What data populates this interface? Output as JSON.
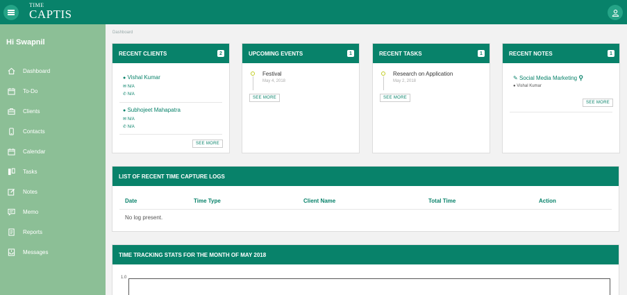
{
  "header": {
    "logo_top": "TIME",
    "logo_bottom": "CAPTIS",
    "menu_icon": "hamburger-icon",
    "user_icon": "user-icon"
  },
  "sidebar": {
    "greeting": "Hi Swapnil",
    "items": [
      {
        "label": "Dashboard",
        "icon": "home-icon"
      },
      {
        "label": "To-Do",
        "icon": "calendar-icon"
      },
      {
        "label": "Clients",
        "icon": "briefcase-icon"
      },
      {
        "label": "Contacts",
        "icon": "phone-icon"
      },
      {
        "label": "Calendar",
        "icon": "calendar-icon"
      },
      {
        "label": "Tasks",
        "icon": "columns-icon"
      },
      {
        "label": "Notes",
        "icon": "edit-icon"
      },
      {
        "label": "Memo",
        "icon": "message-icon"
      },
      {
        "label": "Reports",
        "icon": "report-icon"
      },
      {
        "label": "Messages",
        "icon": "inbox-icon"
      }
    ]
  },
  "breadcrumb": "Dashboard",
  "cards": {
    "clients": {
      "title": "RECENT CLIENTS",
      "count": "2",
      "items": [
        {
          "name": "Vishal Kumar",
          "email": "N/A",
          "phone": "N/A"
        },
        {
          "name": "Subhojeet Mahapatra",
          "email": "N/A",
          "phone": "N/A"
        }
      ],
      "see_more": "SEE MORE"
    },
    "events": {
      "title": "UPCOMING EVENTS",
      "count": "1",
      "items": [
        {
          "title": "Festival",
          "date": "May 4, 2018"
        }
      ],
      "see_more": "SEE MORE"
    },
    "tasks": {
      "title": "RECENT TASKS",
      "count": "1",
      "items": [
        {
          "title": "Research on Application",
          "date": "May 2, 2018"
        }
      ],
      "see_more": "SEE MORE"
    },
    "notes": {
      "title": "RECENT NOTES",
      "count": "1",
      "items": [
        {
          "title": "Social Media Marketing",
          "author": "Vishal Kumar"
        }
      ],
      "see_more": "SEE MORE"
    }
  },
  "logs": {
    "title": "LIST OF RECENT TIME CAPTURE LOGS",
    "columns": [
      "Date",
      "Time Type",
      "Client Name",
      "Total Time",
      "Action"
    ],
    "empty_text": "No log present."
  },
  "stats": {
    "title": "TIME TRACKING STATS FOR THE MONTH OF MAY 2018",
    "y_tick": "1.0"
  },
  "colors": {
    "primary": "#08826a",
    "sidebar": "#8cbf96",
    "accent_ring": "#c0cc22"
  }
}
